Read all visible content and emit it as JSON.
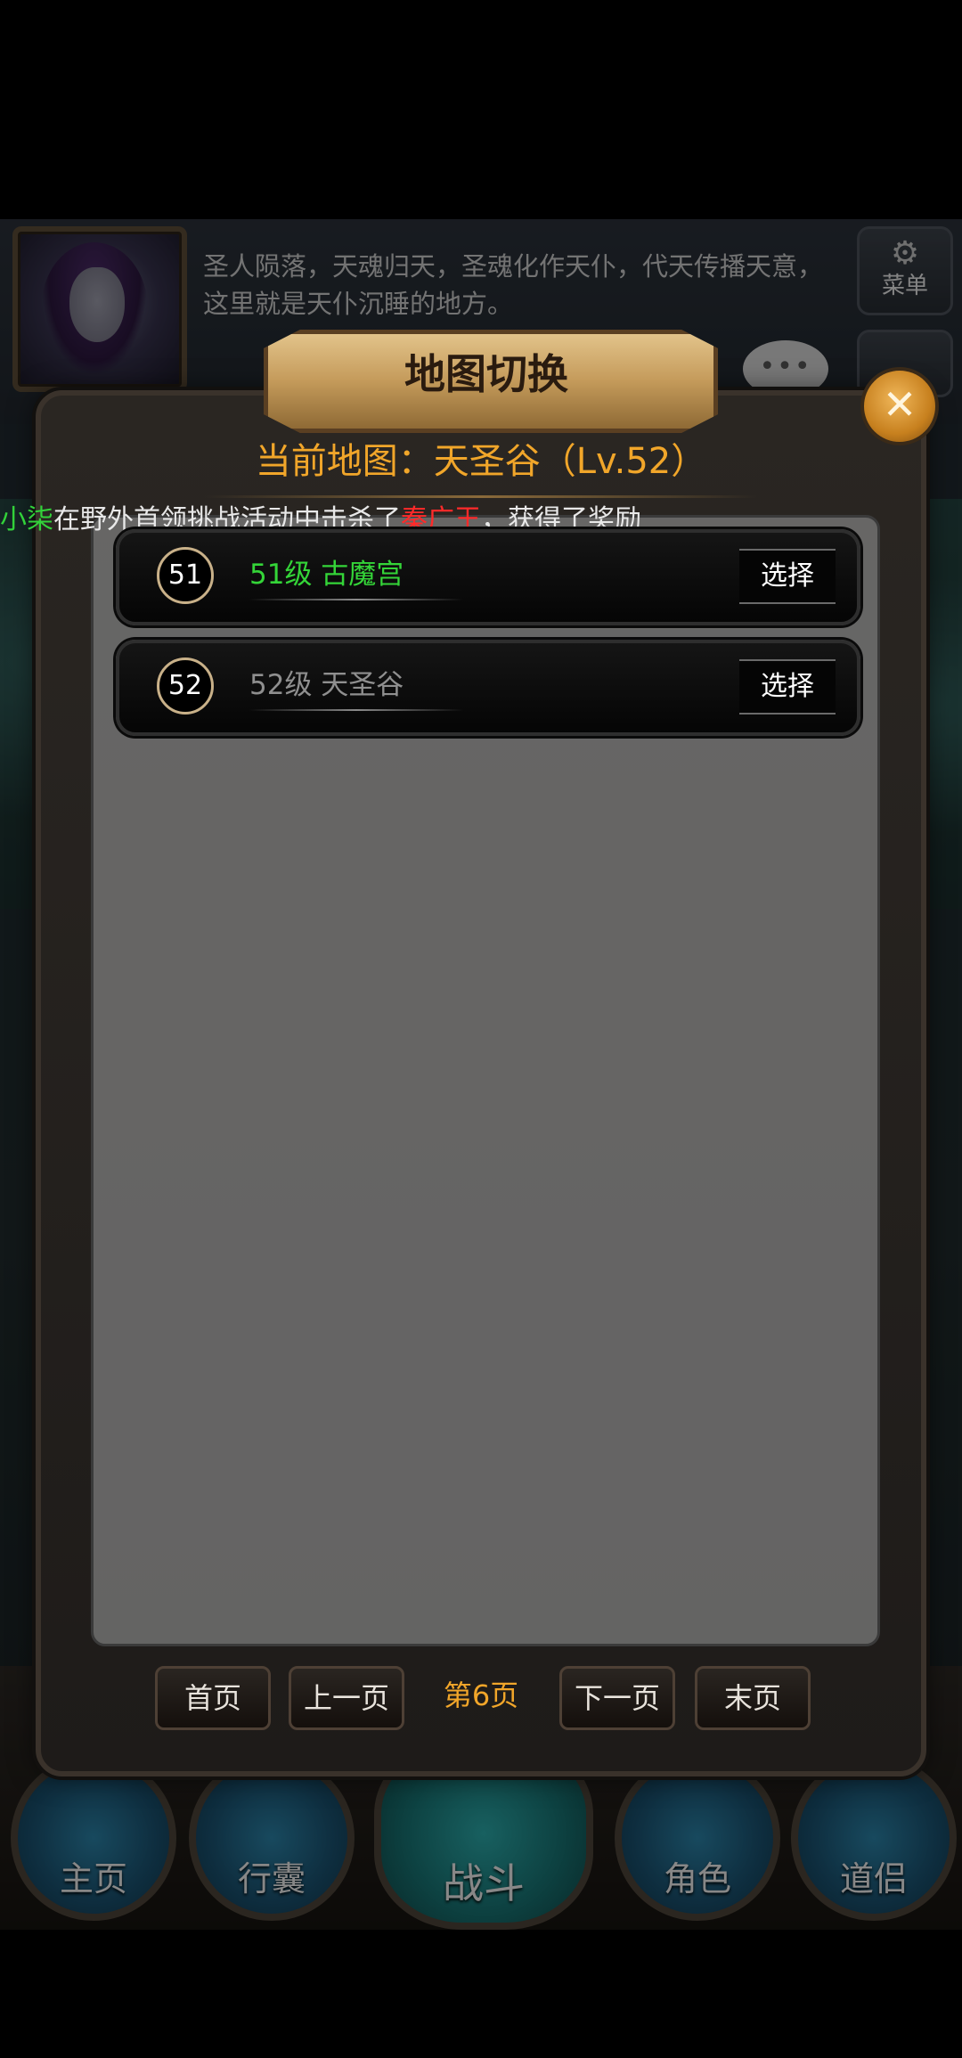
{
  "header": {
    "story_text": "圣人陨落，天魂归天，圣魂化作天仆，代天传播天意，这里就是天仆沉睡的地方。",
    "menu_label": "菜单"
  },
  "modal": {
    "title": "地图切换",
    "close_symbol": "✕",
    "current_map": "当前地图：天圣谷（Lv.52）",
    "broadcast": {
      "player": "小柒",
      "text_1": "在野外首领挑战活动中击杀了",
      "boss": "秦广王",
      "text_2": "，获得了奖励"
    },
    "maps": [
      {
        "level": "51",
        "name": "51级 古魔宫",
        "select_label": "选择",
        "color": "#34d538"
      },
      {
        "level": "52",
        "name": "52级 天圣谷",
        "select_label": "选择",
        "color": "#8f8f8f"
      }
    ],
    "pager": {
      "first": "首页",
      "prev": "上一页",
      "current": "第6页",
      "next": "下一页",
      "last": "末页"
    }
  },
  "bottom_nav": [
    {
      "label": "主页"
    },
    {
      "label": "行囊"
    },
    {
      "label": "战斗"
    },
    {
      "label": "角色"
    },
    {
      "label": "道侣"
    }
  ],
  "colors": {
    "accent_gold": "#f1a62a",
    "player_green": "#32d23a",
    "boss_red": "#ff2a2a"
  },
  "icons": {
    "menu": "gear-icon",
    "chat": "chat-bubble-icon",
    "close": "close-icon"
  }
}
